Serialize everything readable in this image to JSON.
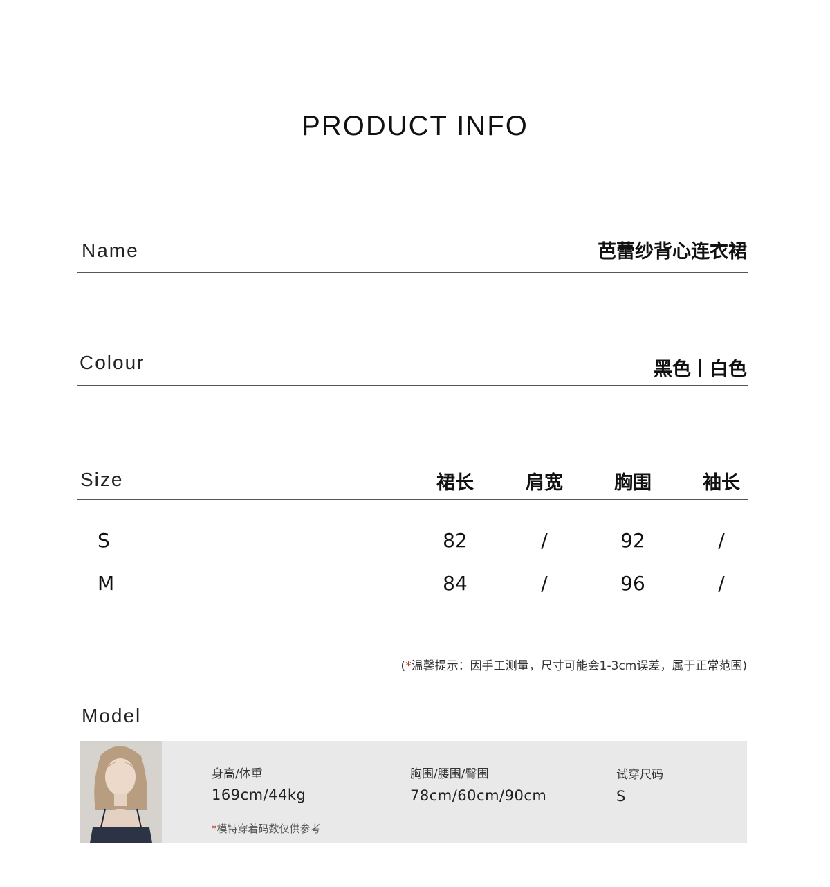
{
  "page_title": "PRODUCT INFO",
  "name": {
    "label": "Name",
    "value": "芭蕾纱背心连衣裙"
  },
  "colour": {
    "label": "Colour",
    "value": "黑色丨白色"
  },
  "size": {
    "label": "Size",
    "columns": [
      "裙长",
      "肩宽",
      "胸围",
      "袖长"
    ],
    "rows": [
      {
        "size": "S",
        "values": [
          "82",
          "/",
          "92",
          "/"
        ]
      },
      {
        "size": "M",
        "values": [
          "84",
          "/",
          "96",
          "/"
        ]
      }
    ]
  },
  "note": {
    "open": "(",
    "star": "*",
    "text": "温馨提示：因手工测量，尺寸可能会1-3cm误差，属于正常范围)"
  },
  "model": {
    "label": "Model",
    "height_weight_label": "身高/体重",
    "height_weight_value": "169cm/44kg",
    "measurements_label": "胸围/腰围/臀围",
    "measurements_value": "78cm/60cm/90cm",
    "fit_size_label": "试穿尺码",
    "fit_size_value": "S",
    "footnote_star": "*",
    "footnote": "模特穿着码数仅供参考"
  },
  "colors": {
    "panel": "#e9e9ea",
    "accent_star": "#c0392b",
    "rule": "#555555"
  }
}
